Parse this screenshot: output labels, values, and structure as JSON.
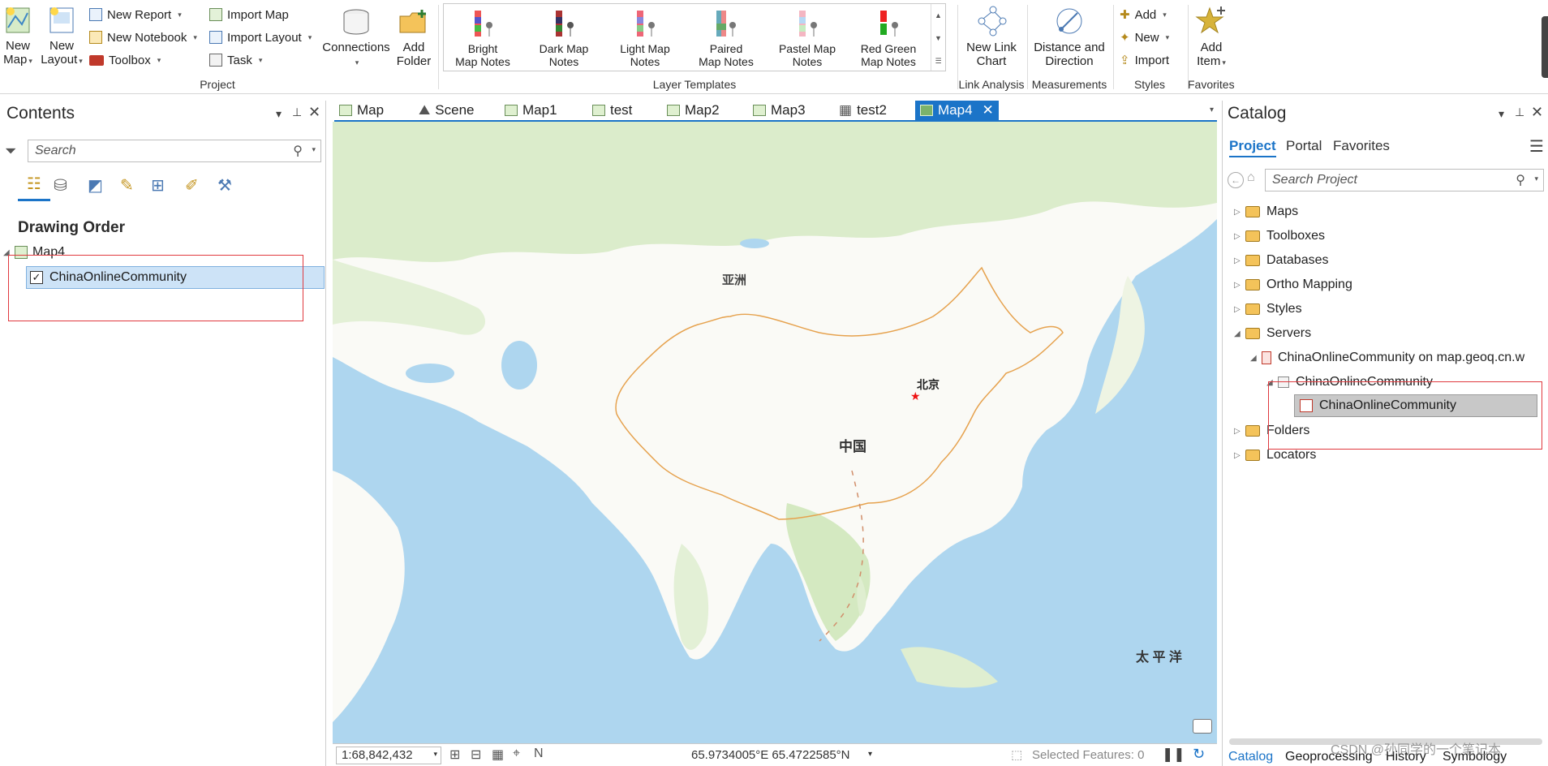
{
  "ribbon": {
    "project": {
      "new_map": "New\nMap",
      "new_layout": "New\nLayout",
      "new_report": "New Report",
      "new_notebook": "New Notebook",
      "toolbox": "Toolbox",
      "import_map": "Import Map",
      "import_layout": "Import Layout",
      "task": "Task",
      "connections": "Connections",
      "add_folder": "Add\nFolder",
      "label": "Project"
    },
    "layer_templates": {
      "items": [
        {
          "label": "Bright\nMap Notes"
        },
        {
          "label": "Dark Map\nNotes"
        },
        {
          "label": "Light Map\nNotes"
        },
        {
          "label": "Paired\nMap Notes"
        },
        {
          "label": "Pastel Map\nNotes"
        },
        {
          "label": "Red Green\nMap Notes"
        }
      ],
      "label": "Layer Templates"
    },
    "link_analysis": {
      "new_link_chart": "New Link\nChart",
      "label": "Link Analysis"
    },
    "measurements": {
      "distance_direction": "Distance and\nDirection",
      "label": "Measurements"
    },
    "styles": {
      "add": "Add",
      "new": "New",
      "import": "Import",
      "label": "Styles"
    },
    "favorites": {
      "add_item": "Add\nItem",
      "label": "Favorites"
    }
  },
  "contents": {
    "title": "Contents",
    "search_placeholder": "Search",
    "section_title": "Drawing Order",
    "map_name": "Map4",
    "layer_name": "ChinaOnlineCommunity"
  },
  "map_tabs": [
    "Map",
    "Scene",
    "Map1",
    "test",
    "Map2",
    "Map3",
    "test2",
    "Map4"
  ],
  "map": {
    "label_asia": "亚洲",
    "label_china": "中国",
    "label_beijing": "北京",
    "label_pacific": "太 平 洋"
  },
  "statusbar": {
    "scale": "1:68,842,432",
    "coords": "65.9734005°E 65.4722585°N",
    "selected": "Selected Features: 0"
  },
  "catalog": {
    "title": "Catalog",
    "tabs": [
      "Project",
      "Portal",
      "Favorites"
    ],
    "search_placeholder": "Search Project",
    "items": [
      {
        "label": "Maps"
      },
      {
        "label": "Toolboxes"
      },
      {
        "label": "Databases"
      },
      {
        "label": "Ortho Mapping"
      },
      {
        "label": "Styles"
      },
      {
        "label": "Servers"
      },
      {
        "label": "ChinaOnlineCommunity on map.geoq.cn.w"
      },
      {
        "label": "ChinaOnlineCommunity"
      },
      {
        "label": "ChinaOnlineCommunity"
      },
      {
        "label": "Folders"
      },
      {
        "label": "Locators"
      }
    ],
    "bottom_tabs": [
      "Catalog",
      "Geoprocessing",
      "History",
      "Symbology"
    ]
  },
  "watermark": "CSDN @孙同学的一个笔记本",
  "colors": {
    "accent": "#1b74c8",
    "highlight_box": "#e0393e",
    "selection": "#cde3f7"
  }
}
